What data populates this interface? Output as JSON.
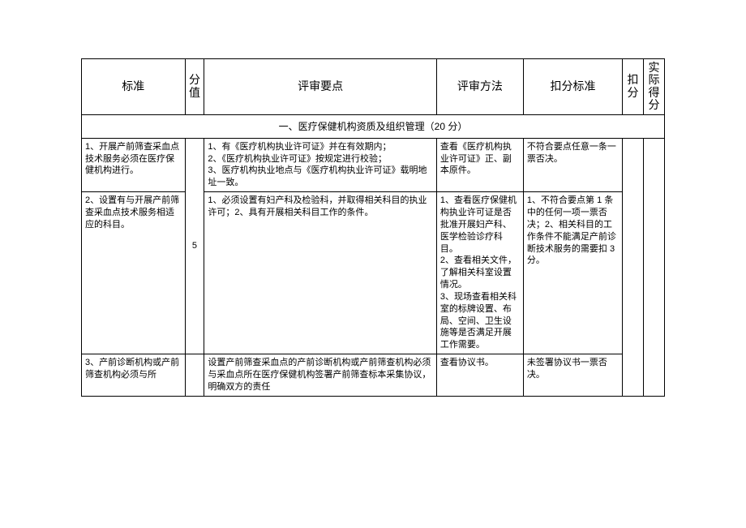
{
  "header": {
    "c1": "标准",
    "c2_a": "分",
    "c2_b": "值",
    "c3": "评审要点",
    "c4": "评审方法",
    "c5": "扣分标准",
    "c6_a": "扣",
    "c6_b": "分",
    "c7_a": "实",
    "c7_b": "际",
    "c7_c": "得",
    "c7_d": "分"
  },
  "section1": {
    "title": "一、医疗保健机构资质及组织管理（20 分）"
  },
  "rows": [
    {
      "std": "1、开展产前筛查采血点技术服务必须在医疗保健机构进行。",
      "score": "5",
      "points": "1、有《医疗机构执业许可证》并在有效期内；\n2、《医疗机构执业许可证》按规定进行校验；\n3、医疗机构执业地点与《医疗机构执业许可证》载明地址一致。",
      "method": "查看《医疗机构执业许可证》正、副本原件。",
      "deduct": "不符合要点任意一条一票否决。"
    },
    {
      "std": "2、设置有与开展产前筛查采血点技术服务相适应的科目。",
      "points": "1、必须设置有妇产科及检验科，并取得相关科目的执业许可；2、具有开展相关科目工作的条件。",
      "method": "1、查看医疗保健机构执业许可证是否批准开展妇产科、医学检验诊疗科目。\n2、查看相关文件，了解相关科室设置情况。\n3、现场查看相关科室的标牌设置、布局、空间、卫生设施等是否满足开展工作需要。",
      "deduct": "1、不符合要点第 1 条中的任何一项一票否决；2、相关科目的工作条件不能满足产前诊断技术服务的需要扣 3 分。"
    },
    {
      "std": "3、产前诊断机构或产前筛查机构必须与所",
      "points": "设置产前筛查采血点的产前诊断机构或产前筛查机构必须与采血点所在医疗保健机构签署产前筛查标本采集协议，明确双方的责任",
      "method": "查看协议书。",
      "deduct": "未签署协议书一票否决。"
    }
  ]
}
